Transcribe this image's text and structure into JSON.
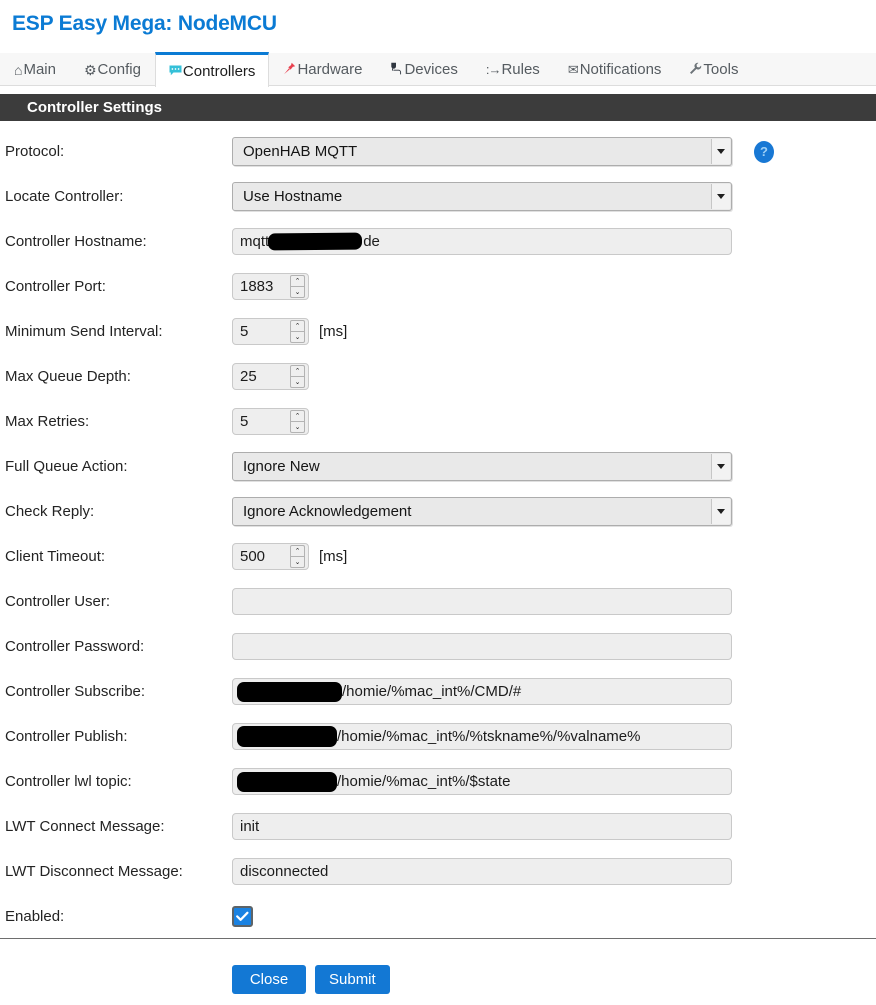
{
  "header": {
    "title": "ESP Easy Mega: NodeMCU",
    "title_color": "#0b7bd4"
  },
  "tabs": [
    {
      "label": "Main",
      "icon": "home-icon",
      "glyph": "⌂",
      "icon_class": "home",
      "active": false
    },
    {
      "label": "Config",
      "icon": "gear-icon",
      "glyph": "✿",
      "icon_class": "gear",
      "active": false
    },
    {
      "label": "Controllers",
      "icon": "speech-bubble-icon",
      "glyph": "▭",
      "icon_class": "bubble",
      "active": true
    },
    {
      "label": "Hardware",
      "icon": "pushpin-icon",
      "glyph": "✦",
      "icon_class": "pin",
      "active": false
    },
    {
      "label": "Devices",
      "icon": "plug-icon",
      "glyph": "⚲",
      "icon_class": "plug",
      "active": false
    },
    {
      "label": "Rules",
      "icon": "arrow-icon",
      "glyph": ":→",
      "icon_class": "rules",
      "active": false
    },
    {
      "label": "Notifications",
      "icon": "envelope-icon",
      "glyph": "✉",
      "icon_class": "mail",
      "active": false
    },
    {
      "label": "Tools",
      "icon": "wrench-icon",
      "glyph": "🔧",
      "icon_class": "wrench",
      "active": false
    }
  ],
  "section": {
    "title": "Controller Settings",
    "background": "#3c3c3c"
  },
  "fields": {
    "protocol": {
      "label": "Protocol:",
      "value": "OpenHAB MQTT",
      "help_glyph": "?"
    },
    "locate_controller": {
      "label": "Locate Controller:",
      "value": "Use Hostname"
    },
    "controller_hostname": {
      "label": "Controller Hostname:",
      "value_prefix": "mqtt",
      "value_suffix": "de",
      "redacted": true
    },
    "controller_port": {
      "label": "Controller Port:",
      "value": "1883"
    },
    "minimum_send_interval": {
      "label": "Minimum Send Interval:",
      "value": "5",
      "unit": "[ms]"
    },
    "max_queue_depth": {
      "label": "Max Queue Depth:",
      "value": "25"
    },
    "max_retries": {
      "label": "Max Retries:",
      "value": "5"
    },
    "full_queue_action": {
      "label": "Full Queue Action:",
      "value": "Ignore New"
    },
    "check_reply": {
      "label": "Check Reply:",
      "value": "Ignore Acknowledgement"
    },
    "client_timeout": {
      "label": "Client Timeout:",
      "value": "500",
      "unit": "[ms]"
    },
    "controller_user": {
      "label": "Controller User:",
      "value": ""
    },
    "controller_password": {
      "label": "Controller Password:",
      "value": ""
    },
    "controller_subscribe": {
      "label": "Controller Subscribe:",
      "value_suffix": "/homie/%mac_int%/CMD/#",
      "redacted": true
    },
    "controller_publish": {
      "label": "Controller Publish:",
      "value_suffix": "/homie/%mac_int%/%tskname%/%valname%",
      "redacted": true
    },
    "controller_lwl_topic": {
      "label": "Controller lwl topic:",
      "value_suffix": "/homie/%mac_int%/$state",
      "redacted": true
    },
    "lwt_connect_message": {
      "label": "LWT Connect Message:",
      "value": "init"
    },
    "lwt_disconnect_message": {
      "label": "LWT Disconnect Message:",
      "value": "disconnected"
    },
    "enabled": {
      "label": "Enabled:",
      "checked": true
    }
  },
  "footer": {
    "close_label": "Close",
    "submit_label": "Submit",
    "button_color": "#1378d4"
  },
  "spinner": {
    "up_glyph": "⌃",
    "down_glyph": "⌄"
  }
}
